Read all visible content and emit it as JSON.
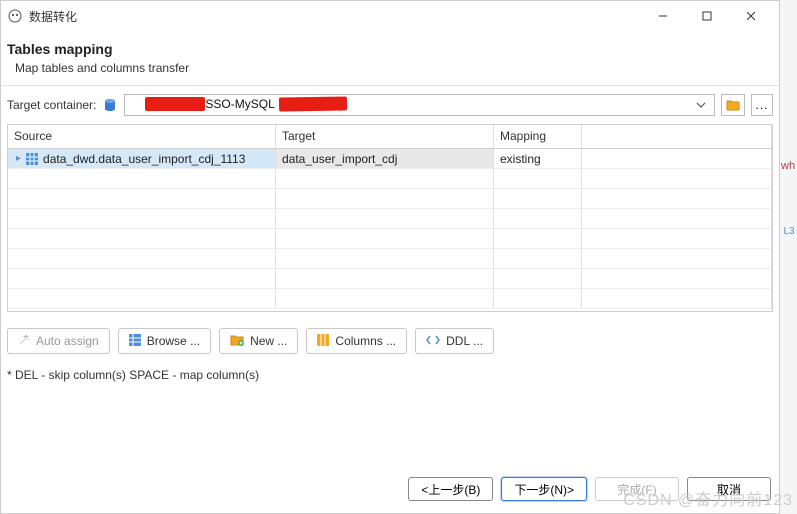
{
  "window": {
    "title": "数据转化"
  },
  "header": {
    "title": "Tables mapping",
    "subtitle": "Map tables and columns transfer"
  },
  "target_container": {
    "label": "Target container:",
    "visible_text": "SSO-MySQL"
  },
  "table": {
    "headers": {
      "source": "Source",
      "target": "Target",
      "mapping": "Mapping"
    },
    "rows": [
      {
        "source": "data_dwd.data_user_import_cdj_1113",
        "target": "data_user_import_cdj",
        "mapping": "existing"
      }
    ]
  },
  "buttons": {
    "auto_assign": "Auto assign",
    "browse": "Browse ...",
    "new": "New ...",
    "columns": "Columns ...",
    "ddl": "DDL ..."
  },
  "note": "* DEL - skip column(s)  SPACE - map column(s)",
  "wizard": {
    "back": "<上一步(B)",
    "next": "下一步(N)>",
    "finish": "完成(F)",
    "cancel": "取消"
  },
  "watermark": "CSDN @奋力向前123",
  "sidepeek": {
    "wh": "wh",
    "l3": "L3"
  }
}
